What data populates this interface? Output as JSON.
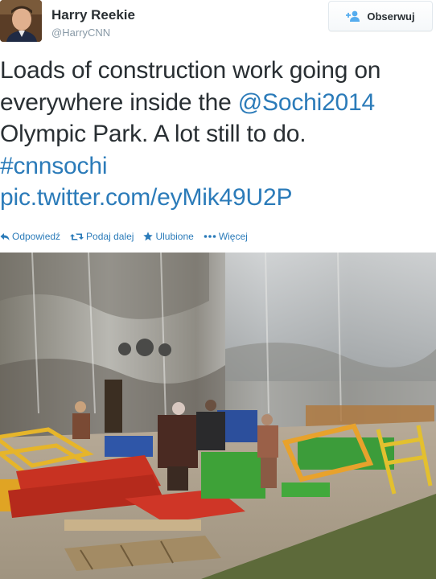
{
  "tweet": {
    "author": {
      "display_name": "Harry Reekie",
      "screen_name": "@HarryCNN",
      "avatar_icon": "profile-photo"
    },
    "follow_button": {
      "label": "Obserwuj",
      "icon": "add-user-icon"
    },
    "text_lines": [
      {
        "before": "Loads of construction work going on",
        "link": "",
        "after": ""
      },
      {
        "before": "everywhere inside the ",
        "link": "@Sochi2014",
        "after": ""
      },
      {
        "before": "Olympic Park. A lot still to do.",
        "link": "",
        "after": ""
      },
      {
        "before": "",
        "link": "#cnnsochi",
        "after": ""
      },
      {
        "before": "",
        "link": "pic.twitter.com/eyMik49U2P",
        "after": ""
      }
    ],
    "actions": [
      {
        "label": "Odpowiedź",
        "icon": "reply-icon"
      },
      {
        "label": "Podaj dalej",
        "icon": "retweet-icon"
      },
      {
        "label": "Ulubione",
        "icon": "star-icon"
      },
      {
        "label": "Więcej",
        "icon": "more-dots-icon"
      }
    ],
    "photo": {
      "icon": "photo-construction-site"
    }
  },
  "colors": {
    "link": "#2b7bb9",
    "text": "#292f33",
    "muted": "#8899a6"
  }
}
